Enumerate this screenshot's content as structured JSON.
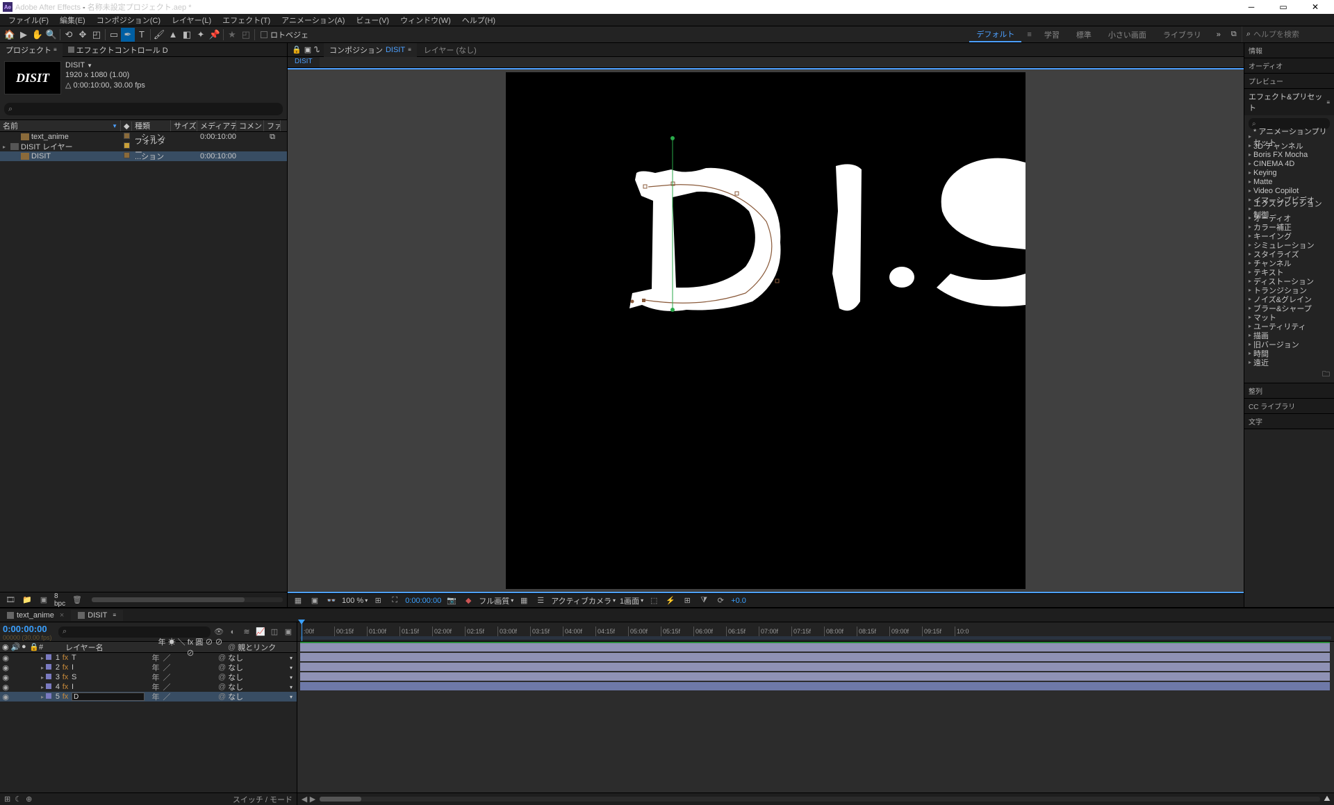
{
  "app": {
    "name": "Adobe After Effects",
    "doc": "名称未設定プロジェクト.aep *"
  },
  "menus": [
    "ファイル(F)",
    "編集(E)",
    "コンポジション(C)",
    "レイヤー(L)",
    "エフェクト(T)",
    "アニメーション(A)",
    "ビュー(V)",
    "ウィンドウ(W)",
    "ヘルプ(H)"
  ],
  "toolbar": {
    "rotobezier_label": "ロトベジェ"
  },
  "workspaces": {
    "items": [
      "デフォルト",
      "学習",
      "標準",
      "小さい画面",
      "ライブラリ"
    ],
    "active": 0,
    "search_placeholder": "ヘルプを検索"
  },
  "project_panel": {
    "tab": "プロジェクト",
    "fx_tab": "エフェクトコントロール D",
    "asset": {
      "name": "DISIT",
      "res": "1920 x 1080 (1.00)",
      "dur": "△ 0:00:10:00, 30.00 fps",
      "thumb_text": "DISIT"
    },
    "columns": {
      "name": "名前",
      "type": "種類",
      "size": "サイズ",
      "media": "メディアデュ...",
      "comment": "コメント",
      "file": "ファ..."
    },
    "rows": [
      {
        "name": "text_anime",
        "type": "...ション",
        "dur": "0:00:10:00",
        "file": true,
        "indent": 1,
        "icon": "comp"
      },
      {
        "name": "DISIT レイヤー",
        "type": "フォルダー",
        "dur": "",
        "indent": 0,
        "icon": "folder",
        "arrow": true,
        "tag": "f"
      },
      {
        "name": "DISIT",
        "type": "...ション",
        "dur": "0:00:10:00",
        "indent": 1,
        "icon": "comp",
        "sel": true
      }
    ],
    "footer": {
      "bpc": "8 bpc"
    }
  },
  "composition": {
    "tab_prefix": "コンポジション",
    "name": "DISIT",
    "layer_tab": "レイヤー (なし)",
    "mini_tab": "DISIT"
  },
  "viewer_footer": {
    "zoom": "100 %",
    "timecode": "0:00:00:00",
    "quality": "フル画質",
    "camera": "アクティブカメラ",
    "views": "1画面",
    "exp": "+0.0"
  },
  "right_panels": [
    "情報",
    "オーディオ",
    "プレビュー"
  ],
  "effects_panel": {
    "title": "エフェクト&プリセット",
    "presets": [
      "* アニメーションプリセット",
      "3D チャンネル",
      "Boris FX Mocha",
      "CINEMA 4D",
      "Keying",
      "Matte",
      "Video Copilot",
      "イマーシブビデオ",
      "エクスプレッション 制御",
      "オーディオ",
      "カラー補正",
      "キーイング",
      "シミュレーション",
      "スタイライズ",
      "チャンネル",
      "テキスト",
      "ディストーション",
      "トランジション",
      "ノイズ&グレイン",
      "ブラー&シャープ",
      "マット",
      "ユーティリティ",
      "描画",
      "旧バージョン",
      "時間",
      "遠近"
    ]
  },
  "right_panels2": [
    "整列",
    "CC ライブラリ",
    "文字"
  ],
  "timeline": {
    "tabs": [
      "text_anime",
      "DISIT"
    ],
    "active": 1,
    "time": "0:00:00:00",
    "time_sub": "00000 (30.00 fps)",
    "cols": {
      "layer_name": "レイヤー名",
      "switches": "年 ☀ ＼ fx 圓 ⊘ ⊘ ⊘",
      "parent": "親とリンク"
    },
    "layers": [
      {
        "n": 1,
        "name": "T",
        "parent": "なし"
      },
      {
        "n": 2,
        "name": "I",
        "parent": "なし"
      },
      {
        "n": 3,
        "name": "S",
        "parent": "なし"
      },
      {
        "n": 4,
        "name": "I",
        "parent": "なし"
      },
      {
        "n": 5,
        "name": "D",
        "parent": "なし",
        "sel": true,
        "editing": true
      }
    ],
    "ruler": [
      ":00f",
      "00:15f",
      "01:00f",
      "01:15f",
      "02:00f",
      "02:15f",
      "03:00f",
      "03:15f",
      "04:00f",
      "04:15f",
      "05:00f",
      "05:15f",
      "06:00f",
      "06:15f",
      "07:00f",
      "07:15f",
      "08:00f",
      "08:15f",
      "09:00f",
      "09:15f",
      "10:0"
    ],
    "foot_label": "スイッチ / モード"
  }
}
